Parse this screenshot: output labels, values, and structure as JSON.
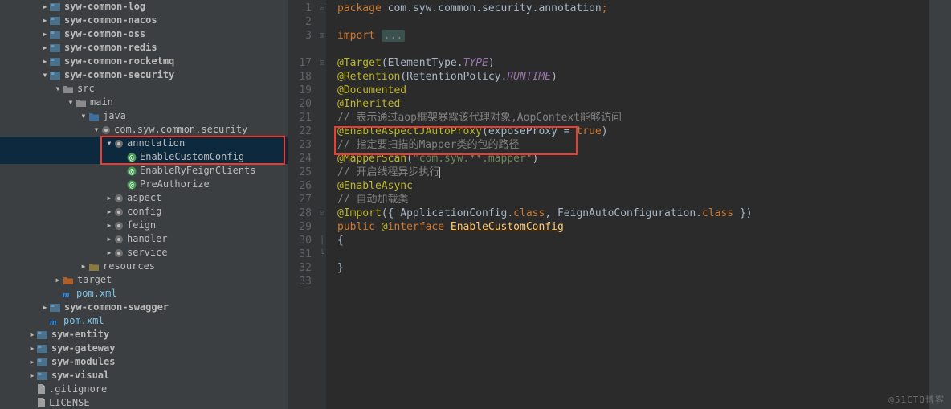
{
  "tree": [
    {
      "d": 2,
      "a": "right",
      "ic": "mod",
      "t": "syw-common-log",
      "b": 1
    },
    {
      "d": 2,
      "a": "right",
      "ic": "mod",
      "t": "syw-common-nacos",
      "b": 1
    },
    {
      "d": 2,
      "a": "right",
      "ic": "mod",
      "t": "syw-common-oss",
      "b": 1
    },
    {
      "d": 2,
      "a": "right",
      "ic": "mod",
      "t": "syw-common-redis",
      "b": 1
    },
    {
      "d": 2,
      "a": "right",
      "ic": "mod",
      "t": "syw-common-rocketmq",
      "b": 1
    },
    {
      "d": 2,
      "a": "down",
      "ic": "mod",
      "t": "syw-common-security",
      "b": 1
    },
    {
      "d": 3,
      "a": "down",
      "ic": "folder",
      "t": "src"
    },
    {
      "d": 4,
      "a": "down",
      "ic": "folder",
      "t": "main"
    },
    {
      "d": 5,
      "a": "down",
      "ic": "srcfolder",
      "t": "java"
    },
    {
      "d": 6,
      "a": "down",
      "ic": "pkg",
      "t": "com.syw.common.security"
    },
    {
      "d": 7,
      "a": "down",
      "ic": "pkg",
      "t": "annotation",
      "sel": true
    },
    {
      "d": 8,
      "a": "",
      "ic": "ann-i",
      "t": "EnableCustomConfig",
      "sel": true
    },
    {
      "d": 8,
      "a": "",
      "ic": "ann-i",
      "t": "EnableRyFeignClients"
    },
    {
      "d": 8,
      "a": "",
      "ic": "ann-i",
      "t": "PreAuthorize"
    },
    {
      "d": 7,
      "a": "right",
      "ic": "pkg",
      "t": "aspect"
    },
    {
      "d": 7,
      "a": "right",
      "ic": "pkg",
      "t": "config"
    },
    {
      "d": 7,
      "a": "right",
      "ic": "pkg",
      "t": "feign"
    },
    {
      "d": 7,
      "a": "right",
      "ic": "pkg",
      "t": "handler"
    },
    {
      "d": 7,
      "a": "right",
      "ic": "pkg",
      "t": "service"
    },
    {
      "d": 5,
      "a": "right",
      "ic": "resfolder",
      "t": "resources"
    },
    {
      "d": 3,
      "a": "right",
      "ic": "target",
      "t": "target"
    },
    {
      "d": 3,
      "a": "",
      "ic": "mvn",
      "t": "pom.xml",
      "mvn": 1
    },
    {
      "d": 2,
      "a": "right",
      "ic": "mod",
      "t": "syw-common-swagger",
      "b": 1
    },
    {
      "d": 2,
      "a": "",
      "ic": "mvn",
      "t": "pom.xml",
      "mvn": 1
    },
    {
      "d": 1,
      "a": "right",
      "ic": "mod",
      "t": "syw-entity",
      "b": 1
    },
    {
      "d": 1,
      "a": "right",
      "ic": "mod",
      "t": "syw-gateway",
      "b": 1
    },
    {
      "d": 1,
      "a": "right",
      "ic": "mod",
      "t": "syw-modules",
      "b": 1
    },
    {
      "d": 1,
      "a": "right",
      "ic": "mod",
      "t": "syw-visual",
      "b": 1
    },
    {
      "d": 1,
      "a": "",
      "ic": "file",
      "t": ".gitignore"
    },
    {
      "d": 1,
      "a": "",
      "ic": "file",
      "t": "LICENSE"
    }
  ],
  "gutter": [
    "1",
    "2",
    "3",
    "",
    "17",
    "18",
    "19",
    "20",
    "21",
    "22",
    "23",
    "24",
    "25",
    "26",
    "27",
    "28",
    "29",
    "30",
    "31",
    "32",
    "33"
  ],
  "folds": {
    "1": "minus",
    "3": "plus",
    "5": "minus",
    "16": "minus",
    "18": "bar",
    "19": "end"
  },
  "code": {
    "l1": {
      "pkg": "package ",
      "path": "com.syw.common.security.annotation",
      "semi": ";"
    },
    "l3": {
      "imp": "import ",
      "fold": "..."
    },
    "l17": {
      "t": "@Target",
      "p1": "(ElementType.",
      "v": "TYPE",
      "p2": ")"
    },
    "l18": {
      "t": "@Retention",
      "p1": "(RetentionPolicy.",
      "v": "RUNTIME",
      "p2": ")"
    },
    "l19": "@Documented",
    "l20": "@Inherited",
    "l21": "// 表示通过aop框架暴露该代理对象,AopContext能够访问",
    "l22": {
      "t": "@EnableAspectJAutoProxy",
      "p1": "(exposeProxy = ",
      "v": "true",
      "p2": ")"
    },
    "l23": "// 指定要扫描的Mapper类的包的路径",
    "l24": {
      "t": "@MapperScan",
      "p1": "(",
      "s": "\"com.syw.**.mapper\"",
      "p2": ")"
    },
    "l25": "// 开启线程异步执行",
    "l26": "@EnableAsync",
    "l27": "// 自动加载类",
    "l28": {
      "t": "@Import",
      "p1": "({ ApplicationConfig.",
      "c": "class",
      "p2": ", FeignAutoConfiguration.",
      "c2": "class",
      "p3": " })"
    },
    "l29": {
      "k1": "public ",
      "a": "@",
      "k2": "interface ",
      "n": "EnableCustomConfig"
    },
    "l30": "{",
    "l32": "}"
  },
  "watermark": "@51CTO博客"
}
